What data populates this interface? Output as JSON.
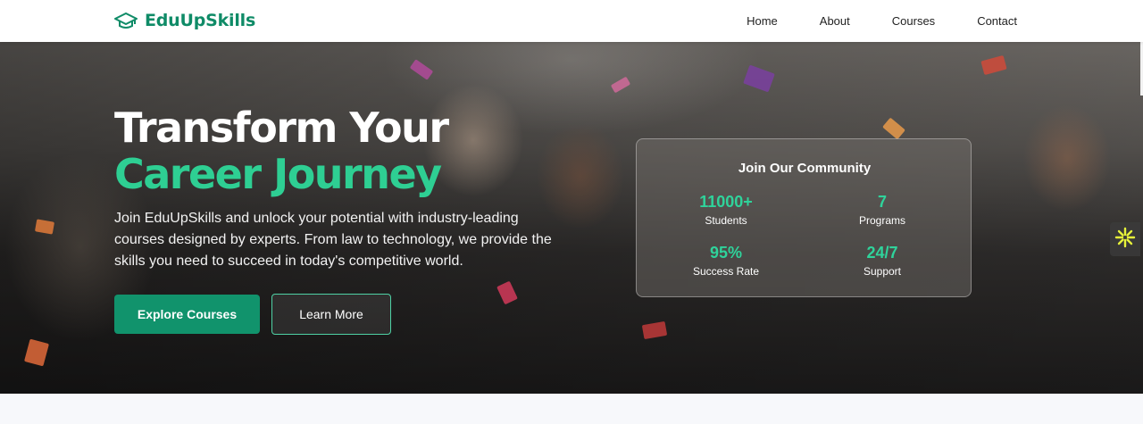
{
  "brand": {
    "name": "EduUpSkills",
    "icon": "graduation-cap-icon",
    "color": "#0f8b67"
  },
  "nav": {
    "items": [
      {
        "label": "Home"
      },
      {
        "label": "About"
      },
      {
        "label": "Courses"
      },
      {
        "label": "Contact"
      }
    ]
  },
  "hero": {
    "headline_line1": "Transform Your",
    "headline_line2": "Career Journey",
    "description": "Join EduUpSkills and unlock your potential with industry-leading courses designed by experts. From law to technology, we provide the skills you need to succeed in today's competitive world.",
    "primary_button": "Explore Courses",
    "secondary_button": "Learn More",
    "accent_color": "#2ecf93"
  },
  "community": {
    "title": "Join Our Community",
    "stats": [
      {
        "value": "11000+",
        "label": "Students"
      },
      {
        "value": "7",
        "label": "Programs"
      },
      {
        "value": "95%",
        "label": "Success Rate"
      },
      {
        "value": "24/7",
        "label": "Support"
      }
    ]
  },
  "widgets": {
    "side_tab_icon": "sparkle-icon"
  }
}
